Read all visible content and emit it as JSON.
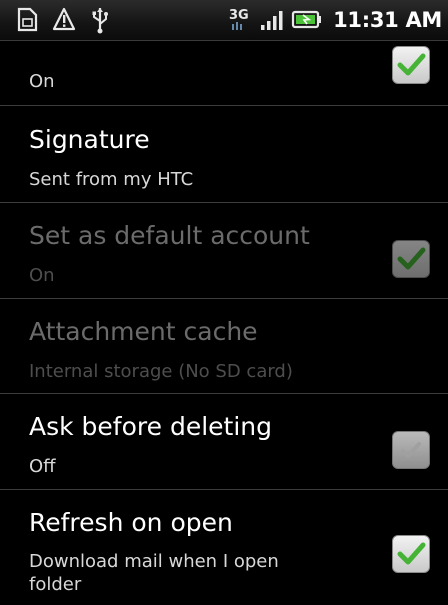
{
  "status_bar": {
    "icons": [
      "sim-card-icon",
      "warning-icon",
      "usb-icon"
    ],
    "network_label": "3G",
    "time": "11:31 AM"
  },
  "settings": {
    "notifications": {
      "summary": "On",
      "checked": true
    },
    "signature": {
      "title": "Signature",
      "summary": "Sent from my HTC"
    },
    "default_account": {
      "title": "Set as default account",
      "summary": "On",
      "checked": true,
      "enabled": false
    },
    "attachment_cache": {
      "title": "Attachment cache",
      "summary": "Internal storage (No SD card)",
      "enabled": false
    },
    "ask_before_deleting": {
      "title": "Ask before deleting",
      "summary": "Off",
      "checked": false
    },
    "refresh_on_open": {
      "title": "Refresh on open",
      "summary_line1": "Download mail when I open",
      "summary_line2": "folder",
      "checked": true
    }
  },
  "colors": {
    "check_green": "#46b336",
    "text_primary": "#ffffff",
    "text_disabled": "#6b6b6b",
    "divider": "#3c3c3c"
  }
}
